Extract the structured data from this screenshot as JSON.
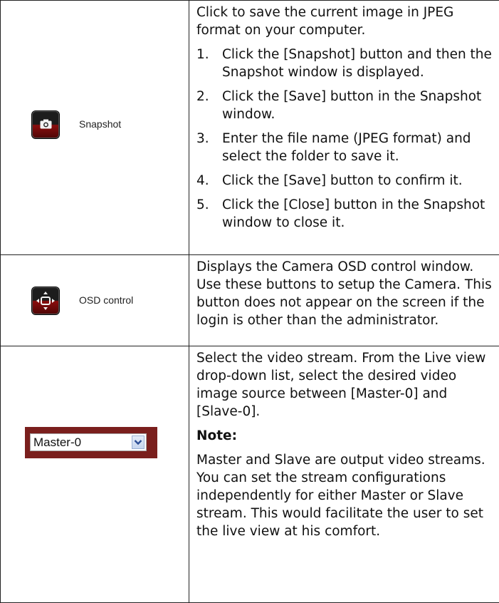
{
  "rows": [
    {
      "button_label": "Snapshot",
      "icon": "camera-icon",
      "intro": "Click to save the current image in JPEG format on your computer.",
      "steps": [
        {
          "num": "1.",
          "text": "Click the [Snapshot] button and then the Snapshot window is displayed."
        },
        {
          "num": "2.",
          "text": "Click the [Save] button in the Snapshot window."
        },
        {
          "num": "3.",
          "text": "Enter the file name (JPEG format) and select the folder to save it."
        },
        {
          "num": "4.",
          "text": "Click the [Save] button to confirm it."
        },
        {
          "num": "5.",
          "text": "Click the [Close] button in the Snapshot window to close it."
        }
      ]
    },
    {
      "button_label": "OSD control",
      "icon": "osd-control-icon",
      "description": "Displays the Camera OSD control window. Use these buttons to setup the Camera. This button does not appear on the screen if the login is other than the administrator."
    },
    {
      "select_value": "Master-0",
      "icon": "chevron-down-icon",
      "description": "Select the video stream. From the Live view drop-down list, select the desired video image source between [Master-0] and [Slave-0].",
      "note_heading": "Note:",
      "note_text": "Master and Slave are output video streams. You can set the stream configurations independently for either Master or Slave stream. This would facilitate the user to set the live view at his comfort."
    }
  ],
  "colors": {
    "button_top": "#1c1c1c",
    "button_bottom": "#8a0d0d",
    "select_frame": "#7a1f1d"
  }
}
